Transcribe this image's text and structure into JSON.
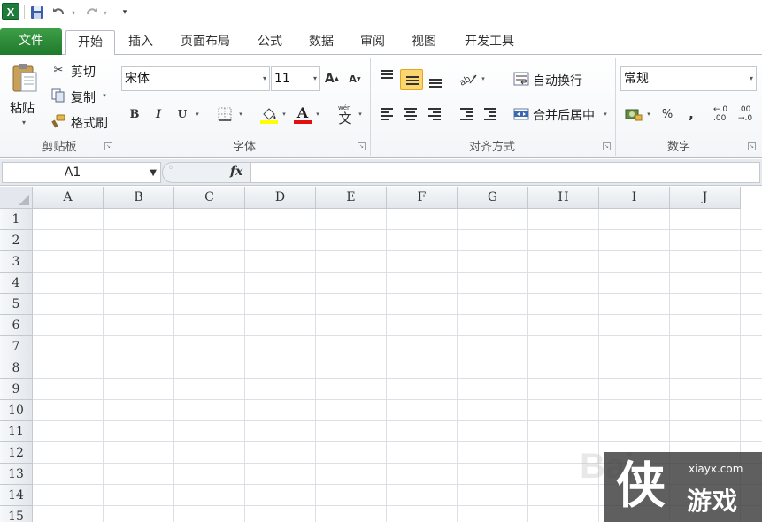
{
  "app": {
    "logo_letter": "X"
  },
  "quick_access": {
    "customize_glyph": "▾"
  },
  "tabs": [
    {
      "label": "文件"
    },
    {
      "label": "开始"
    },
    {
      "label": "插入"
    },
    {
      "label": "页面布局"
    },
    {
      "label": "公式"
    },
    {
      "label": "数据"
    },
    {
      "label": "审阅"
    },
    {
      "label": "视图"
    },
    {
      "label": "开发工具"
    }
  ],
  "ribbon": {
    "clipboard": {
      "group_label": "剪贴板",
      "paste_label": "粘贴",
      "cut_label": "剪切",
      "copy_label": "复制",
      "format_painter_label": "格式刷"
    },
    "font": {
      "group_label": "字体",
      "font_name": "宋体",
      "font_size": "11",
      "bold": "B",
      "italic": "I",
      "underline": "U",
      "grow": "A",
      "shrink": "A",
      "fill_color": "#ffff00",
      "font_color": "#e01010",
      "phonetic": "wén"
    },
    "alignment": {
      "group_label": "对齐方式",
      "wrap_text_label": "自动换行",
      "merge_center_label": "合并后居中"
    },
    "number": {
      "group_label": "数字",
      "format": "常规",
      "percent": "%",
      "comma": ",",
      "increase_decimal": "←.0 .00",
      "decrease_decimal": ".00 →.0"
    }
  },
  "formula_bar": {
    "name_box": "A1",
    "fx": "fx",
    "formula": ""
  },
  "grid": {
    "columns": [
      "A",
      "B",
      "C",
      "D",
      "E",
      "F",
      "G",
      "H",
      "I",
      "J"
    ],
    "rows": [
      "1",
      "2",
      "3",
      "4",
      "5",
      "6",
      "7",
      "8",
      "9",
      "10",
      "11",
      "12",
      "13",
      "14",
      "15"
    ]
  },
  "watermark": {
    "site": "xiayx.com",
    "name": "游戏",
    "baidu": "Bai"
  }
}
